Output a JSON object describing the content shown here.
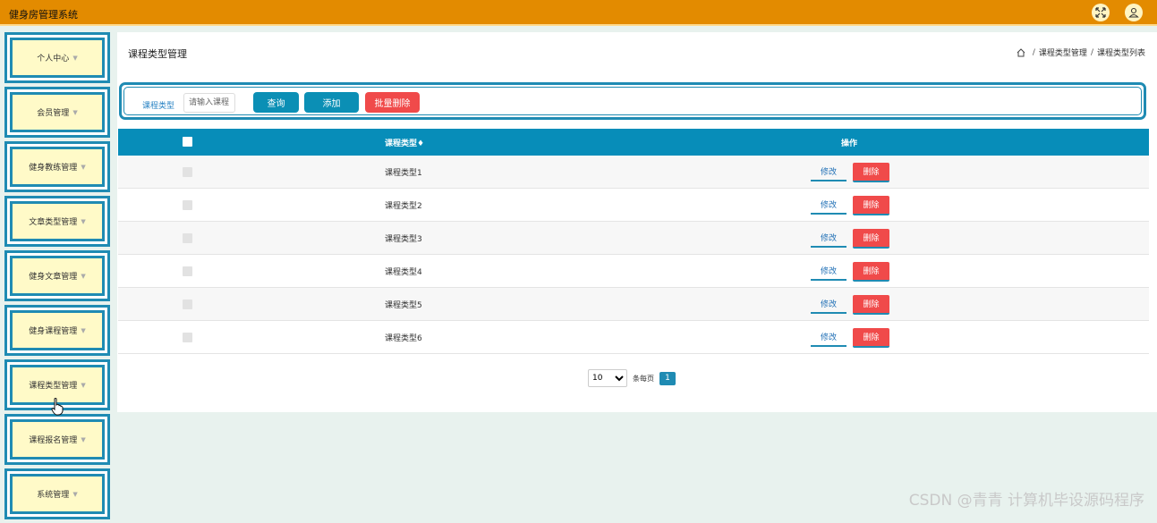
{
  "app": {
    "title": "健身房管理系统"
  },
  "header": {
    "fullscreen_icon": "expand-icon",
    "user_icon": "user-icon"
  },
  "sidebar": {
    "items": [
      {
        "label": "个人中心"
      },
      {
        "label": "会员管理"
      },
      {
        "label": "健身教练管理"
      },
      {
        "label": "文章类型管理"
      },
      {
        "label": "健身文章管理"
      },
      {
        "label": "健身课程管理"
      },
      {
        "label": "课程类型管理"
      },
      {
        "label": "课程报名管理"
      },
      {
        "label": "系统管理"
      }
    ]
  },
  "page": {
    "title": "课程类型管理",
    "breadcrumb": [
      "课程类型管理",
      "课程类型列表"
    ]
  },
  "search": {
    "label": "课程类型",
    "placeholder": "请输入课程",
    "query_label": "查询",
    "add_label": "添加",
    "batch_delete_label": "批量删除"
  },
  "table": {
    "columns": {
      "name": "课程类型",
      "sort_mark": "♦",
      "operation": "操作"
    },
    "edit_label": "修改",
    "delete_label": "删除",
    "rows": [
      {
        "name": "课程类型1"
      },
      {
        "name": "课程类型2"
      },
      {
        "name": "课程类型3"
      },
      {
        "name": "课程类型4"
      },
      {
        "name": "课程类型5"
      },
      {
        "name": "课程类型6"
      }
    ]
  },
  "pagination": {
    "page_size": "10",
    "per_page_label": "条每页",
    "current_page": "1"
  },
  "watermark": "CSDN @青青  计算机毕设源码程序",
  "colors": {
    "topbar": "#e38b00",
    "accent": "#0b8fb5",
    "danger": "#f04a4a",
    "menu_bg": "#fffac8"
  }
}
